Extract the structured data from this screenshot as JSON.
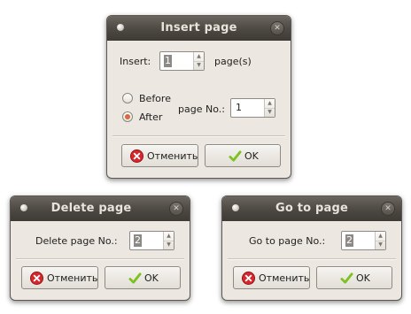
{
  "insert_dialog": {
    "title": "Insert page",
    "close_icon": "close-icon",
    "insert_label": "Insert:",
    "insert_value": "1",
    "pages_suffix": "page(s)",
    "before_label": "Before",
    "after_label": "After",
    "selected_position": "After",
    "page_no_label": "page No.:",
    "page_no_value": "1",
    "cancel_label": "Отменить",
    "ok_label": "OK"
  },
  "delete_dialog": {
    "title": "Delete page",
    "page_no_label": "Delete page No.:",
    "page_no_value": "2",
    "cancel_label": "Отменить",
    "ok_label": "OK"
  },
  "goto_dialog": {
    "title": "Go to page",
    "page_no_label": "Go to page No.:",
    "page_no_value": "2",
    "cancel_label": "Отменить",
    "ok_label": "OK"
  },
  "colors": {
    "titlebar": "#4c4842",
    "dialog_bg": "#ece8e1",
    "radio_accent": "#d96a3b",
    "cancel_icon": "#d8262b",
    "ok_icon": "#7cc220"
  },
  "icons": [
    "title-dot-icon",
    "close-icon",
    "spin-up-icon",
    "spin-down-icon",
    "cancel-icon",
    "check-icon"
  ]
}
